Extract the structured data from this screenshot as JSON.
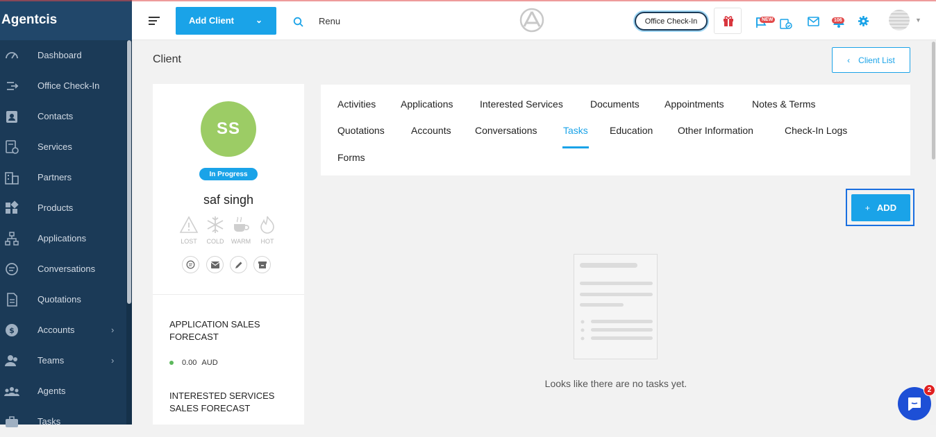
{
  "app": {
    "brand": "Agentcis"
  },
  "sidebar": {
    "items": [
      {
        "label": "Dashboard",
        "icon": "dashboard-icon",
        "chevron": ""
      },
      {
        "label": "Office Check-In",
        "icon": "check-in-icon",
        "chevron": ""
      },
      {
        "label": "Contacts",
        "icon": "contacts-icon",
        "chevron": ""
      },
      {
        "label": "Services",
        "icon": "services-icon",
        "chevron": ""
      },
      {
        "label": "Partners",
        "icon": "partners-icon",
        "chevron": ""
      },
      {
        "label": "Products",
        "icon": "products-icon",
        "chevron": ""
      },
      {
        "label": "Applications",
        "icon": "applications-icon",
        "chevron": ""
      },
      {
        "label": "Conversations",
        "icon": "conversations-icon",
        "chevron": ""
      },
      {
        "label": "Quotations",
        "icon": "quotations-icon",
        "chevron": ""
      },
      {
        "label": "Accounts",
        "icon": "accounts-icon",
        "chevron": "›"
      },
      {
        "label": "Teams",
        "icon": "teams-icon",
        "chevron": "›"
      },
      {
        "label": "Agents",
        "icon": "agents-icon",
        "chevron": ""
      },
      {
        "label": "Tasks",
        "icon": "tasks-icon",
        "chevron": ""
      }
    ]
  },
  "topbar": {
    "add_client_label": "Add Client",
    "search_value": "Renu",
    "office_checkin_label": "Office Check-In",
    "new_badge": "NEW",
    "notification_count": "106"
  },
  "page": {
    "title": "Client",
    "client_list_label": "Client List"
  },
  "profile": {
    "initials": "SS",
    "status": "In Progress",
    "name": "saf singh",
    "temperatures": [
      "LOST",
      "COLD",
      "WARM",
      "HOT"
    ],
    "application_forecast_title": "APPLICATION SALES FORECAST",
    "application_forecast_amount": "0.00",
    "application_forecast_currency": "AUD",
    "interested_forecast_title": "INTERESTED SERVICES SALES FORECAST"
  },
  "tabs": {
    "activities": "Activities",
    "applications": "Applications",
    "interested_services": "Interested Services",
    "documents": "Documents",
    "appointments": "Appointments",
    "notes_terms": "Notes & Terms",
    "quotations": "Quotations",
    "accounts": "Accounts",
    "conversations": "Conversations",
    "tasks": "Tasks",
    "education": "Education",
    "other_information": "Other Information",
    "checkin_logs": "Check-In Logs",
    "forms": "Forms",
    "active": "Tasks"
  },
  "tasks": {
    "add_label": "ADD",
    "empty_message": "Looks like there are no tasks yet."
  },
  "chat": {
    "unread": "2"
  },
  "colors": {
    "accent": "#1aa3e8",
    "sidebar": "#1b3a57",
    "avatar": "#9ccc65"
  }
}
